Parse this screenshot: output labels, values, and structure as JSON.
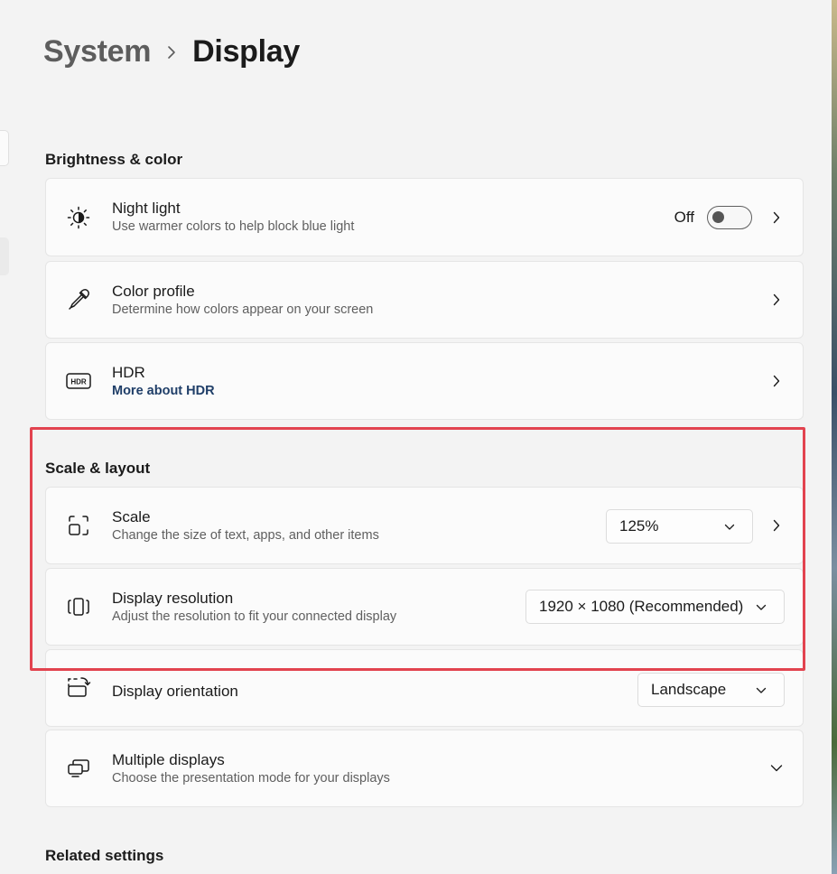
{
  "breadcrumb": {
    "parent": "System",
    "current": "Display"
  },
  "sections": {
    "brightness": "Brightness & color",
    "scale_layout": "Scale & layout",
    "related": "Related settings"
  },
  "night_light": {
    "title": "Night light",
    "subtitle": "Use warmer colors to help block blue light",
    "state_label": "Off",
    "on": false,
    "icon": "brightness-icon"
  },
  "color_profile": {
    "title": "Color profile",
    "subtitle": "Determine how colors appear on your screen",
    "icon": "eyedropper-icon"
  },
  "hdr": {
    "title": "HDR",
    "link": "More about HDR",
    "icon": "hdr-icon",
    "icon_text": "HDR"
  },
  "scale": {
    "title": "Scale",
    "subtitle": "Change the size of text, apps, and other items",
    "value": "125%",
    "icon": "scale-icon"
  },
  "resolution": {
    "title": "Display resolution",
    "subtitle": "Adjust the resolution to fit your connected display",
    "value": "1920 × 1080 (Recommended)",
    "icon": "resolution-icon"
  },
  "orientation": {
    "title": "Display orientation",
    "value": "Landscape",
    "icon": "orientation-icon"
  },
  "multiple_displays": {
    "title": "Multiple displays",
    "subtitle": "Choose the presentation mode for your displays",
    "icon": "multiple-displays-icon"
  },
  "colors": {
    "highlight": "#e2434f",
    "link": "#1f3e68"
  }
}
